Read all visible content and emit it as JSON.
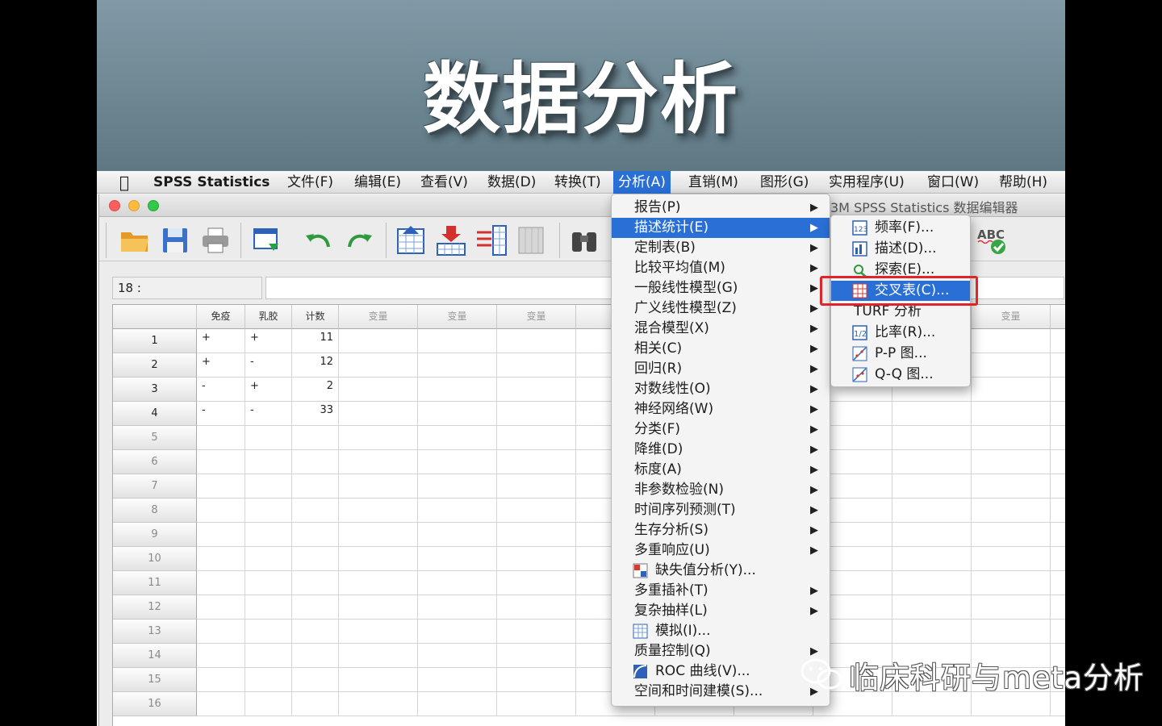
{
  "banner": {
    "title": "数据分析"
  },
  "menubar": {
    "app": "SPSS Statistics",
    "items": [
      "文件(F)",
      "编辑(E)",
      "查看(V)",
      "数据(D)",
      "转换(T)",
      "分析(A)",
      "直销(M)",
      "图形(G)",
      "实用程序(U)",
      "窗口(W)",
      "帮助(H)"
    ],
    "active": "分析(A)"
  },
  "window": {
    "title": "3M SPSS Statistics 数据编辑器"
  },
  "cellbar": {
    "ref": "18 :"
  },
  "grid": {
    "columns": [
      "免疫",
      "乳胶",
      "计数",
      "变量",
      "变量",
      "变量",
      "变量"
    ],
    "rows": [
      {
        "n": "1",
        "c1": "+",
        "c2": "+",
        "c3": "11"
      },
      {
        "n": "2",
        "c1": "+",
        "c2": "-",
        "c3": "12"
      },
      {
        "n": "3",
        "c1": "-",
        "c2": "+",
        "c3": "2"
      },
      {
        "n": "4",
        "c1": "-",
        "c2": "-",
        "c3": "33"
      },
      {
        "n": "5"
      },
      {
        "n": "6"
      },
      {
        "n": "7"
      },
      {
        "n": "8"
      },
      {
        "n": "9"
      },
      {
        "n": "10"
      },
      {
        "n": "11"
      },
      {
        "n": "12"
      },
      {
        "n": "13"
      },
      {
        "n": "14"
      },
      {
        "n": "15"
      },
      {
        "n": "16"
      }
    ]
  },
  "analyze_menu": {
    "items": [
      {
        "label": "报告(P)",
        "sub": true
      },
      {
        "label": "描述统计(E)",
        "sub": true,
        "highlighted": true
      },
      {
        "label": "定制表(B)",
        "sub": true
      },
      {
        "label": "比较平均值(M)",
        "sub": true
      },
      {
        "label": "一般线性模型(G)",
        "sub": true
      },
      {
        "label": "广义线性模型(Z)",
        "sub": true
      },
      {
        "label": "混合模型(X)",
        "sub": true
      },
      {
        "label": "相关(C)",
        "sub": true
      },
      {
        "label": "回归(R)",
        "sub": true
      },
      {
        "label": "对数线性(O)",
        "sub": true
      },
      {
        "label": "神经网络(W)",
        "sub": true
      },
      {
        "label": "分类(F)",
        "sub": true
      },
      {
        "label": "降维(D)",
        "sub": true
      },
      {
        "label": "标度(A)",
        "sub": true
      },
      {
        "label": "非参数检验(N)",
        "sub": true
      },
      {
        "label": "时间序列预测(T)",
        "sub": true
      },
      {
        "label": "生存分析(S)",
        "sub": true
      },
      {
        "label": "多重响应(U)",
        "sub": true
      },
      {
        "label": "缺失值分析(Y)...",
        "icon": "missing-values-icon"
      },
      {
        "label": "多重插补(T)",
        "sub": true
      },
      {
        "label": "复杂抽样(L)",
        "sub": true
      },
      {
        "label": "模拟(I)...",
        "icon": "simulation-icon"
      },
      {
        "label": "质量控制(Q)",
        "sub": true
      },
      {
        "label": "ROC 曲线(V)...",
        "icon": "roc-curve-icon"
      },
      {
        "label": "空间和时间建模(S)...",
        "sub": true
      }
    ]
  },
  "descriptive_submenu": {
    "items": [
      {
        "label": "频率(F)...",
        "icon": "frequencies-icon"
      },
      {
        "label": "描述(D)...",
        "icon": "descriptives-icon"
      },
      {
        "label": "探索(E)...",
        "icon": "explore-icon"
      },
      {
        "label": "交叉表(C)...",
        "icon": "crosstabs-icon",
        "highlighted": true
      },
      {
        "label": "TURF 分析"
      },
      {
        "label": "比率(R)...",
        "icon": "ratio-icon"
      },
      {
        "label": "P-P 图...",
        "icon": "pp-plot-icon"
      },
      {
        "label": "Q-Q 图...",
        "icon": "qq-plot-icon"
      }
    ]
  },
  "toolbar_right": {
    "spell_label": "ABC"
  },
  "watermark": {
    "text": "临床科研与meta分析"
  },
  "colors": {
    "accent": "#2a6fd6",
    "highlight_box": "#e0242a"
  }
}
